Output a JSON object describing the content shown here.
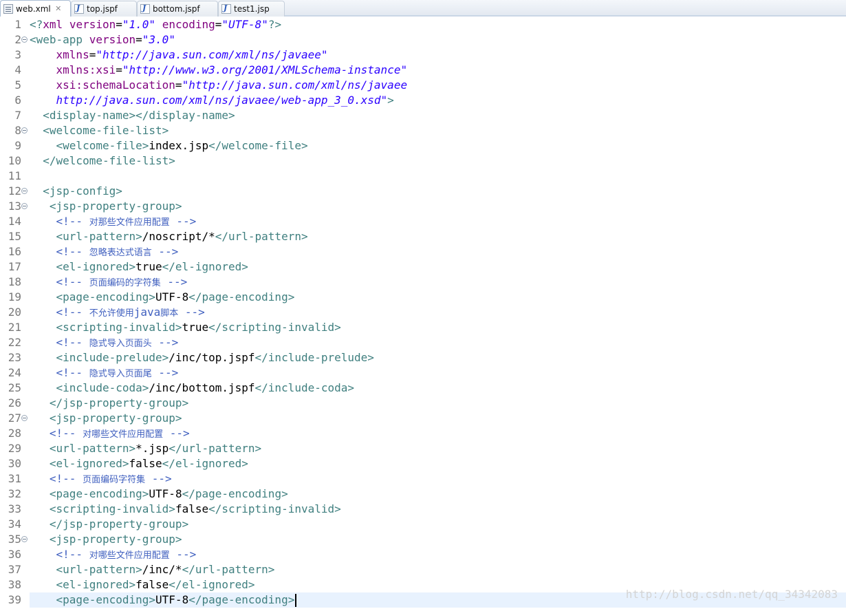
{
  "tabs": [
    {
      "label": "web.xml",
      "icon": "xml-file-icon",
      "active": true,
      "close": "✕"
    },
    {
      "label": "top.jspf",
      "icon": "jsp-file-icon",
      "active": false
    },
    {
      "label": "bottom.jspf",
      "icon": "jsp-file-icon",
      "active": false
    },
    {
      "label": "test1.jsp",
      "icon": "jsp-file-icon",
      "active": false
    }
  ],
  "colors": {
    "tag": "#3f7f7f",
    "attribute": "#7f007f",
    "value": "#2a00ff",
    "text": "#000000",
    "comment": "#3f5fbf",
    "line_number": "#787878",
    "current_line": "#e8f2fe"
  },
  "editor": {
    "current_line": 39,
    "lines": [
      {
        "n": "1",
        "fold": false,
        "indent": "",
        "tokens": [
          [
            "t",
            "<?"
          ],
          [
            "a",
            "xml"
          ],
          [
            "x",
            " "
          ],
          [
            "a",
            "version"
          ],
          [
            "x",
            "="
          ],
          [
            "v",
            "\"1.0\""
          ],
          [
            "x",
            " "
          ],
          [
            "a",
            "encoding"
          ],
          [
            "x",
            "="
          ],
          [
            "v",
            "\"UTF-8\""
          ],
          [
            "t",
            "?>"
          ]
        ]
      },
      {
        "n": "2",
        "fold": true,
        "indent": "",
        "tokens": [
          [
            "t",
            "<web-app"
          ],
          [
            "x",
            " "
          ],
          [
            "a",
            "version"
          ],
          [
            "x",
            "="
          ],
          [
            "v",
            "\"3.0\""
          ]
        ]
      },
      {
        "n": "3",
        "fold": false,
        "indent": "    ",
        "tokens": [
          [
            "a",
            "xmlns"
          ],
          [
            "x",
            "="
          ],
          [
            "v",
            "\"http://java.sun.com/xml/ns/javaee\""
          ]
        ]
      },
      {
        "n": "4",
        "fold": false,
        "indent": "    ",
        "tokens": [
          [
            "a",
            "xmlns:xsi"
          ],
          [
            "x",
            "="
          ],
          [
            "v",
            "\"http://www.w3.org/2001/XMLSchema-instance\""
          ]
        ]
      },
      {
        "n": "5",
        "fold": false,
        "indent": "    ",
        "tokens": [
          [
            "a",
            "xsi:schemaLocation"
          ],
          [
            "x",
            "="
          ],
          [
            "v",
            "\"http://java.sun.com/xml/ns/javaee"
          ]
        ]
      },
      {
        "n": "6",
        "fold": false,
        "indent": "    ",
        "tokens": [
          [
            "v",
            "http://java.sun.com/xml/ns/javaee/web-app_3_0.xsd\""
          ],
          [
            "t",
            ">"
          ]
        ]
      },
      {
        "n": "7",
        "fold": false,
        "indent": "  ",
        "tokens": [
          [
            "t",
            "<display-name></display-name>"
          ]
        ]
      },
      {
        "n": "8",
        "fold": true,
        "indent": "  ",
        "tokens": [
          [
            "t",
            "<welcome-file-list>"
          ]
        ]
      },
      {
        "n": "9",
        "fold": false,
        "indent": "    ",
        "tokens": [
          [
            "t",
            "<welcome-file>"
          ],
          [
            "x",
            "index.jsp"
          ],
          [
            "t",
            "</welcome-file>"
          ]
        ]
      },
      {
        "n": "10",
        "fold": false,
        "indent": "  ",
        "tokens": [
          [
            "t",
            "</welcome-file-list>"
          ]
        ]
      },
      {
        "n": "11",
        "fold": false,
        "indent": "",
        "tokens": []
      },
      {
        "n": "12",
        "fold": true,
        "indent": "  ",
        "tokens": [
          [
            "t",
            "<jsp-config>"
          ]
        ]
      },
      {
        "n": "13",
        "fold": true,
        "indent": "   ",
        "tokens": [
          [
            "t",
            "<jsp-property-group>"
          ]
        ]
      },
      {
        "n": "14",
        "fold": false,
        "indent": "    ",
        "tokens": [
          [
            "c",
            "<!-- "
          ],
          [
            "cz",
            "对那些文件应用配置"
          ],
          [
            "c",
            " -->"
          ]
        ]
      },
      {
        "n": "15",
        "fold": false,
        "indent": "    ",
        "tokens": [
          [
            "t",
            "<url-pattern>"
          ],
          [
            "x",
            "/noscript/*"
          ],
          [
            "t",
            "</url-pattern>"
          ]
        ]
      },
      {
        "n": "16",
        "fold": false,
        "indent": "    ",
        "tokens": [
          [
            "c",
            "<!-- "
          ],
          [
            "cz",
            "忽略表达式语言"
          ],
          [
            "c",
            " -->"
          ]
        ]
      },
      {
        "n": "17",
        "fold": false,
        "indent": "    ",
        "tokens": [
          [
            "t",
            "<el-ignored>"
          ],
          [
            "x",
            "true"
          ],
          [
            "t",
            "</el-ignored>"
          ]
        ]
      },
      {
        "n": "18",
        "fold": false,
        "indent": "    ",
        "tokens": [
          [
            "c",
            "<!-- "
          ],
          [
            "cz",
            "页面编码的字符集"
          ],
          [
            "c",
            " -->"
          ]
        ]
      },
      {
        "n": "19",
        "fold": false,
        "indent": "    ",
        "tokens": [
          [
            "t",
            "<page-encoding>"
          ],
          [
            "x",
            "UTF-8"
          ],
          [
            "t",
            "</page-encoding>"
          ]
        ]
      },
      {
        "n": "20",
        "fold": false,
        "indent": "    ",
        "tokens": [
          [
            "c",
            "<!-- "
          ],
          [
            "cz",
            "不允许使用"
          ],
          [
            "c",
            "java"
          ],
          [
            "cz",
            "脚本"
          ],
          [
            "c",
            " -->"
          ]
        ]
      },
      {
        "n": "21",
        "fold": false,
        "indent": "    ",
        "tokens": [
          [
            "t",
            "<scripting-invalid>"
          ],
          [
            "x",
            "true"
          ],
          [
            "t",
            "</scripting-invalid>"
          ]
        ]
      },
      {
        "n": "22",
        "fold": false,
        "indent": "    ",
        "tokens": [
          [
            "c",
            "<!-- "
          ],
          [
            "cz",
            "隐式导入页面头"
          ],
          [
            "c",
            " -->"
          ]
        ]
      },
      {
        "n": "23",
        "fold": false,
        "indent": "    ",
        "tokens": [
          [
            "t",
            "<include-prelude>"
          ],
          [
            "x",
            "/inc/top.jspf"
          ],
          [
            "t",
            "</include-prelude>"
          ]
        ]
      },
      {
        "n": "24",
        "fold": false,
        "indent": "    ",
        "tokens": [
          [
            "c",
            "<!-- "
          ],
          [
            "cz",
            "隐式导入页面尾"
          ],
          [
            "c",
            " -->"
          ]
        ]
      },
      {
        "n": "25",
        "fold": false,
        "indent": "    ",
        "tokens": [
          [
            "t",
            "<include-coda>"
          ],
          [
            "x",
            "/inc/bottom.jspf"
          ],
          [
            "t",
            "</include-coda>"
          ]
        ]
      },
      {
        "n": "26",
        "fold": false,
        "indent": "   ",
        "tokens": [
          [
            "t",
            "</jsp-property-group>"
          ]
        ]
      },
      {
        "n": "27",
        "fold": true,
        "indent": "   ",
        "tokens": [
          [
            "t",
            "<jsp-property-group>"
          ]
        ]
      },
      {
        "n": "28",
        "fold": false,
        "indent": "   ",
        "tokens": [
          [
            "c",
            "<!-- "
          ],
          [
            "cz",
            "对哪些文件应用配置"
          ],
          [
            "c",
            " -->"
          ]
        ]
      },
      {
        "n": "29",
        "fold": false,
        "indent": "   ",
        "tokens": [
          [
            "t",
            "<url-pattern>"
          ],
          [
            "x",
            "*.jsp"
          ],
          [
            "t",
            "</url-pattern>"
          ]
        ]
      },
      {
        "n": "30",
        "fold": false,
        "indent": "   ",
        "tokens": [
          [
            "t",
            "<el-ignored>"
          ],
          [
            "x",
            "false"
          ],
          [
            "t",
            "</el-ignored>"
          ]
        ]
      },
      {
        "n": "31",
        "fold": false,
        "indent": "   ",
        "tokens": [
          [
            "c",
            "<!-- "
          ],
          [
            "cz",
            "页面编码字符集"
          ],
          [
            "c",
            " -->"
          ]
        ]
      },
      {
        "n": "32",
        "fold": false,
        "indent": "   ",
        "tokens": [
          [
            "t",
            "<page-encoding>"
          ],
          [
            "x",
            "UTF-8"
          ],
          [
            "t",
            "</page-encoding>"
          ]
        ]
      },
      {
        "n": "33",
        "fold": false,
        "indent": "   ",
        "tokens": [
          [
            "t",
            "<scripting-invalid>"
          ],
          [
            "x",
            "false"
          ],
          [
            "t",
            "</scripting-invalid>"
          ]
        ]
      },
      {
        "n": "34",
        "fold": false,
        "indent": "   ",
        "tokens": [
          [
            "t",
            "</jsp-property-group>"
          ]
        ]
      },
      {
        "n": "35",
        "fold": true,
        "indent": "   ",
        "tokens": [
          [
            "t",
            "<jsp-property-group>"
          ]
        ]
      },
      {
        "n": "36",
        "fold": false,
        "indent": "    ",
        "tokens": [
          [
            "c",
            "<!-- "
          ],
          [
            "cz",
            "对哪些文件应用配置"
          ],
          [
            "c",
            " -->"
          ]
        ]
      },
      {
        "n": "37",
        "fold": false,
        "indent": "    ",
        "tokens": [
          [
            "t",
            "<url-pattern>"
          ],
          [
            "x",
            "/inc/*"
          ],
          [
            "t",
            "</url-pattern>"
          ]
        ]
      },
      {
        "n": "38",
        "fold": false,
        "indent": "    ",
        "tokens": [
          [
            "t",
            "<el-ignored>"
          ],
          [
            "x",
            "false"
          ],
          [
            "t",
            "</el-ignored>"
          ]
        ]
      },
      {
        "n": "39",
        "fold": false,
        "indent": "    ",
        "tokens": [
          [
            "t",
            "<page-encoding>"
          ],
          [
            "x",
            "UTF-8"
          ],
          [
            "t",
            "</page-encoding>"
          ]
        ]
      }
    ]
  },
  "watermark": "http://blog.csdn.net/qq_34342083"
}
